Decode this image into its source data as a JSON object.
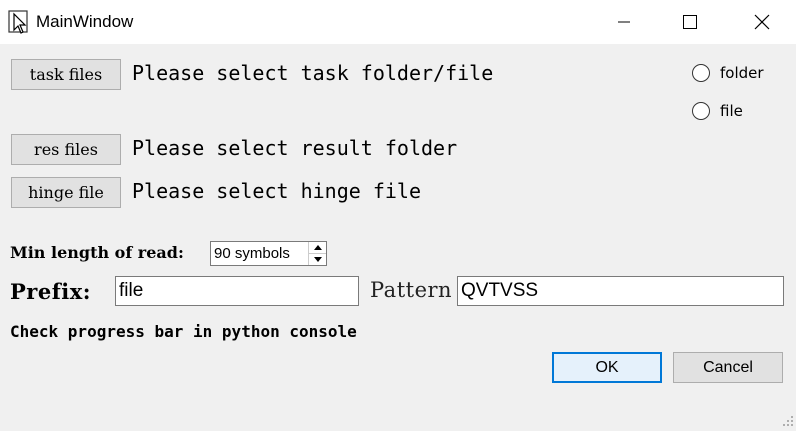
{
  "window": {
    "title": "MainWindow",
    "controls": {
      "minimize": "minimize-icon",
      "maximize": "maximize-icon",
      "close": "close-icon"
    }
  },
  "task": {
    "button_label": "task files",
    "status": "Please select task folder/file"
  },
  "mode": {
    "options": [
      {
        "label": "folder",
        "selected": false
      },
      {
        "label": "file",
        "selected": false
      }
    ]
  },
  "res": {
    "button_label": "res files",
    "status": "Please select result folder"
  },
  "hinge": {
    "button_label": "hinge file",
    "status": "Please select hinge file"
  },
  "min_length": {
    "label": "Min length of read:",
    "value": "90 symbols"
  },
  "prefix": {
    "label": "Prefix:",
    "value": "file"
  },
  "pattern": {
    "label": "Pattern",
    "value": "QVTVSS"
  },
  "note": "Check progress bar in python console",
  "dialog": {
    "ok_label": "OK",
    "cancel_label": "Cancel"
  },
  "colors": {
    "accent": "#0078d7",
    "background": "#f0f0f0",
    "button": "#e1e1e1"
  }
}
